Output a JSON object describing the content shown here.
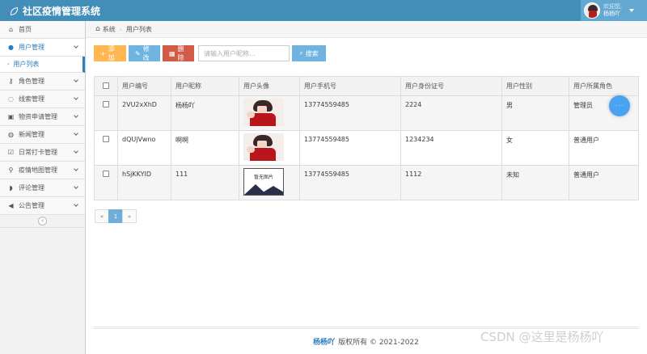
{
  "app": {
    "title": "社区疫情管理系统"
  },
  "user": {
    "greeting": "欢迎您,",
    "name": "杨杨吖"
  },
  "sidebar": {
    "items": [
      {
        "label": "首页",
        "icon": "home-icon",
        "glyph": "⌂"
      },
      {
        "label": "用户管理",
        "icon": "user-icon",
        "glyph": "●",
        "open": true
      },
      {
        "label": "角色管理",
        "icon": "key-icon",
        "glyph": "⚷"
      },
      {
        "label": "线索管理",
        "icon": "lightbulb-icon",
        "glyph": "◌"
      },
      {
        "label": "物资申请管理",
        "icon": "bag-icon",
        "glyph": "▣"
      },
      {
        "label": "新闻管理",
        "icon": "globe-icon",
        "glyph": "◍"
      },
      {
        "label": "日常打卡管理",
        "icon": "check-square-icon",
        "glyph": "☑"
      },
      {
        "label": "疫情地图管理",
        "icon": "map-pin-icon",
        "glyph": "⚲"
      },
      {
        "label": "评论管理",
        "icon": "comment-icon",
        "glyph": "◗"
      },
      {
        "label": "公告管理",
        "icon": "bullhorn-icon",
        "glyph": "◀"
      }
    ],
    "sub_item": "用户列表",
    "collapse_glyph": "«"
  },
  "breadcrumb": {
    "root": "系统",
    "current": "用户列表"
  },
  "toolbar": {
    "add": "添加",
    "edit": "修改",
    "delete": "删除",
    "search_placeholder": "请输入用户昵称...",
    "search": "搜索"
  },
  "table": {
    "headers": [
      "用户编号",
      "用户昵称",
      "用户头像",
      "用户手机号",
      "用户身份证号",
      "用户性别",
      "用户所属角色"
    ],
    "rows": [
      {
        "id": "2VU2xXhD",
        "nickname": "杨杨吖",
        "avatar": "anime",
        "phone": "13774559485",
        "idcard": "2224",
        "gender": "男",
        "role": "管理员"
      },
      {
        "id": "dQUjVwno",
        "nickname": "啊啊",
        "avatar": "anime",
        "phone": "13774559485",
        "idcard": "1234234",
        "gender": "女",
        "role": "普通用户"
      },
      {
        "id": "hSjKKYID",
        "nickname": "111",
        "avatar": "none",
        "phone": "13774559485",
        "idcard": "1112",
        "gender": "未知",
        "role": "普通用户"
      }
    ],
    "noimg_text": "暂无图片"
  },
  "pagination": {
    "prev": "«",
    "page": "1",
    "next": "»"
  },
  "footer": {
    "owner": "杨杨吖",
    "text": "版权所有 © 2021-2022"
  },
  "watermark": "CSDN @这里是杨杨吖",
  "colors": {
    "topbar": "#438eb9",
    "accent": "#2b7dbc",
    "add": "#ffb752",
    "edit": "#6fb3e0",
    "delete": "#d15b47"
  }
}
